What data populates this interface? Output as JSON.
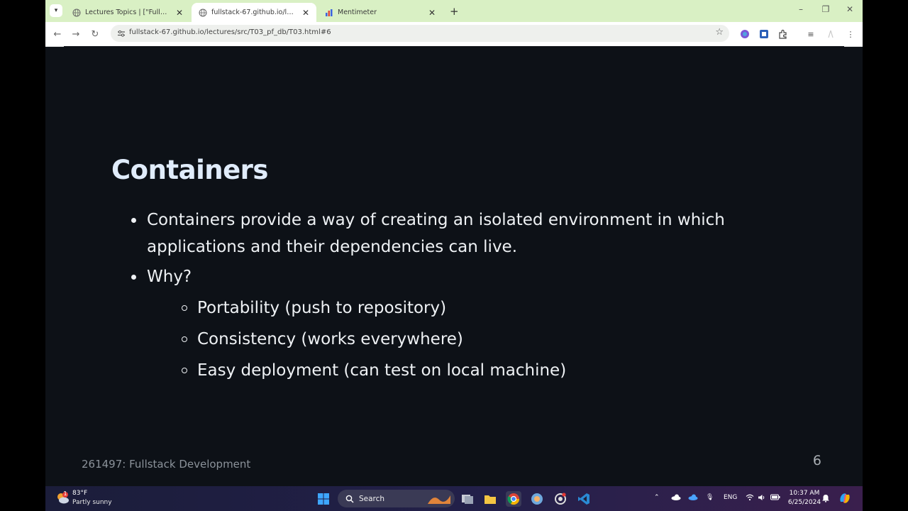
{
  "browser": {
    "tabs": [
      {
        "title": "Lectures Topics | [\"Fullstack 67 (",
        "close_glyph": "✕",
        "active": false
      },
      {
        "title": "fullstack-67.github.io/lectures/s",
        "close_glyph": "✕",
        "active": true
      },
      {
        "title": "Mentimeter",
        "close_glyph": "✕",
        "active": false
      }
    ],
    "new_tab_glyph": "+",
    "url": "fullstack-67.github.io/lectures/src/T03_pf_db/T03.html#6",
    "accent_color": "#d9f0c4"
  },
  "slide": {
    "title": "Containers",
    "bullets": [
      {
        "text": "Containers provide a way of creating an isolated environment in which applications and their dependencies can live."
      },
      {
        "text": "Why?",
        "sub": [
          "Portability (push to repository)",
          "Consistency (works everywhere)",
          "Easy deployment (can test on local machine)"
        ]
      }
    ],
    "footer": "261497: Fullstack Development",
    "page_number": "6"
  },
  "taskbar": {
    "weather_badge": "1",
    "weather_temp": "83°F",
    "weather_desc": "Partly sunny",
    "search_label": "Search",
    "lang": "ENG",
    "time": "10:37 AM",
    "date": "6/25/2024"
  }
}
